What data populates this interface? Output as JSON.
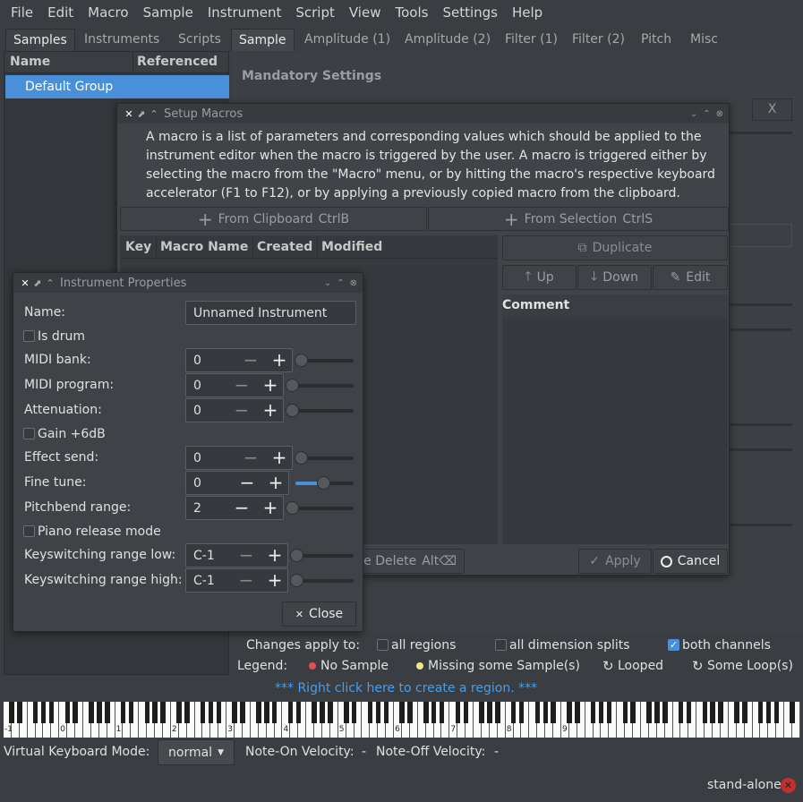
{
  "menu": [
    "File",
    "Edit",
    "Macro",
    "Sample",
    "Instrument",
    "Script",
    "View",
    "Tools",
    "Settings",
    "Help"
  ],
  "left_tabs": [
    "Samples",
    "Instruments",
    "Scripts"
  ],
  "left_columns": [
    "Name",
    "Referenced"
  ],
  "left_items": [
    "Default Group"
  ],
  "right_tabs": [
    "Sample",
    "Amplitude (1)",
    "Amplitude (2)",
    "Filter (1)",
    "Filter (2)",
    "Pitch",
    "Misc"
  ],
  "mandatory": "Mandatory Settings",
  "x_button": "X",
  "macros": {
    "title": "Setup Macros",
    "description": "A macro is a list of parameters and corresponding values which should be applied to the instrument editor when the macro is triggered by the user. A macro is triggered either by selecting the macro from the \"Macro\" menu, or by hitting the macro's respective keyboard accelerator (F1 to F12), or by applying a previously copied macro from the clipboard.",
    "from_clipboard": "From Clipboard",
    "from_clipboard_key": "CtrlB",
    "from_selection": "From Selection",
    "from_selection_key": "CtrlS",
    "columns": [
      "Key",
      "Macro Name",
      "Created",
      "Modified"
    ],
    "duplicate": "Duplicate",
    "up": "Up",
    "down": "Down",
    "edit": "Edit",
    "comment": "Comment",
    "delete_partial": "e Delete",
    "delete_key": "Alt⌫",
    "apply": "Apply",
    "cancel": "Cancel"
  },
  "inst": {
    "title": "Instrument Properties",
    "name_label": "Name:",
    "name_value": "Unnamed Instrument",
    "is_drum": "Is drum",
    "midi_bank": "MIDI bank:",
    "midi_bank_val": "0",
    "midi_program": "MIDI program:",
    "midi_program_val": "0",
    "attenuation": "Attenuation:",
    "attenuation_val": "0",
    "gain": "Gain +6dB",
    "effect_send": "Effect send:",
    "effect_send_val": "0",
    "fine_tune": "Fine tune:",
    "fine_tune_val": "0",
    "pitchbend": "Pitchbend range:",
    "pitchbend_val": "2",
    "piano_release": "Piano release mode",
    "ks_low": "Keyswitching range low:",
    "ks_low_val": "C-1",
    "ks_high": "Keyswitching range high:",
    "ks_high_val": "C-1",
    "close": "Close"
  },
  "bottom": {
    "changes_apply": "Changes apply to:",
    "all_regions": "all regions",
    "all_dim": "all dimension splits",
    "both_channels": "both channels",
    "legend": "Legend:",
    "no_sample": "No Sample",
    "missing": "Missing some Sample(s)",
    "looped": "Looped",
    "some_loops": "Some Loop(s)",
    "right_click": "*** Right click here to create a region. ***"
  },
  "octaves": [
    "-1",
    "0",
    "1",
    "2",
    "3",
    "4",
    "5",
    "6",
    "7",
    "8",
    "9"
  ],
  "status": {
    "vk_mode_label": "Virtual Keyboard Mode:",
    "vk_mode": "normal",
    "note_on": "Note-On Velocity:",
    "note_on_val": "-",
    "note_off": "Note-Off Velocity:",
    "note_off_val": "-",
    "standalone": "stand-alone"
  },
  "colors": {
    "accent": "#4a90d9",
    "bg": "#3a3d41",
    "link": "#4a9ee8",
    "red": "#e05050",
    "yellow": "#f0e68c"
  }
}
